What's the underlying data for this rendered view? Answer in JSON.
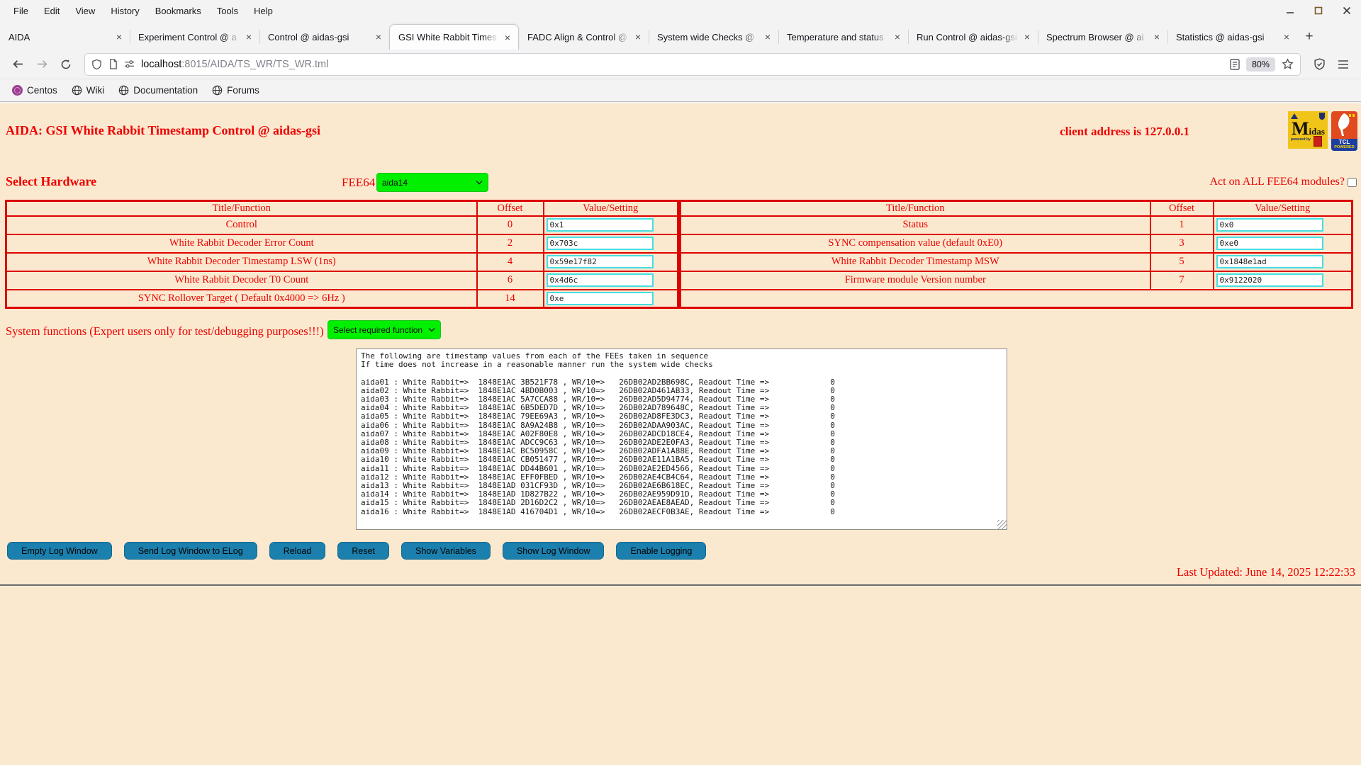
{
  "browser": {
    "menu_items": [
      "File",
      "Edit",
      "View",
      "History",
      "Bookmarks",
      "Tools",
      "Help"
    ],
    "tabs": [
      {
        "title": "AIDA"
      },
      {
        "title": "Experiment Control @ a"
      },
      {
        "title": "Control @ aidas-gsi"
      },
      {
        "title": "GSI White Rabbit Times"
      },
      {
        "title": "FADC Align & Control @"
      },
      {
        "title": "System wide Checks @"
      },
      {
        "title": "Temperature and status"
      },
      {
        "title": "Run Control @ aidas-gsi"
      },
      {
        "title": "Spectrum Browser @ ai"
      },
      {
        "title": "Statistics @ aidas-gsi"
      }
    ],
    "close_glyph": "×",
    "new_tab_label": "+",
    "address": {
      "host": "localhost",
      "rest": ":8015/AIDA/TS_WR/TS_WR.tml"
    },
    "zoom_badge": "80%",
    "bookmarks": [
      "Centos",
      "Wiki",
      "Documentation",
      "Forums"
    ]
  },
  "page": {
    "title": "AIDA: GSI White Rabbit Timestamp Control @ aidas-gsi",
    "client_address": "client address is 127.0.0.1",
    "logos": {
      "midas_text": "Midas",
      "midas_powered": "powered by",
      "tcl_line1": "TCL",
      "tcl_line2": "POWERED"
    },
    "hardware": {
      "label": "Select Hardware",
      "fee_label": "FEE64",
      "fee_value": "aida14",
      "act_all_label": "Act on ALL FEE64 modules?"
    },
    "table": {
      "headers": [
        "Title/Function",
        "Offset",
        "Value/Setting"
      ],
      "left_rows": [
        {
          "title": "Control",
          "offset": "0",
          "value": "0x1"
        },
        {
          "title": "White Rabbit Decoder Error Count",
          "offset": "2",
          "value": "0x703c"
        },
        {
          "title": "White Rabbit Decoder Timestamp LSW (1ns)",
          "offset": "4",
          "value": "0x59e17f82"
        },
        {
          "title": "White Rabbit Decoder T0 Count",
          "offset": "6",
          "value": "0x4d6c"
        },
        {
          "title": "SYNC Rollover Target ( Default 0x4000 => 6Hz )",
          "offset": "14",
          "value": "0xe"
        }
      ],
      "right_rows": [
        {
          "title": "Status",
          "offset": "1",
          "value": "0x0"
        },
        {
          "title": "SYNC compensation value (default 0xE0)",
          "offset": "3",
          "value": "0xe0"
        },
        {
          "title": "White Rabbit Decoder Timestamp MSW",
          "offset": "5",
          "value": "0x1848e1ad"
        },
        {
          "title": "Firmware module Version number",
          "offset": "7",
          "value": "0x9122020"
        }
      ]
    },
    "system_functions": {
      "label": "System functions (Expert users only for test/debugging purposes!!!)",
      "selected": "Select required function"
    },
    "log_text": "The following are timestamp values from each of the FEEs taken in sequence\nIf time does not increase in a reasonable manner run the system wide checks\n\naida01 : White Rabbit=>  1848E1AC 3B521F78 , WR/10=>   26DB02AD2BB698C, Readout Time =>             0\naida02 : White Rabbit=>  1848E1AC 4BD0B003 , WR/10=>   26DB02AD461AB33, Readout Time =>             0\naida03 : White Rabbit=>  1848E1AC 5A7CCA88 , WR/10=>   26DB02AD5D94774, Readout Time =>             0\naida04 : White Rabbit=>  1848E1AC 6B5DED7D , WR/10=>   26DB02AD789648C, Readout Time =>             0\naida05 : White Rabbit=>  1848E1AC 79EE69A3 , WR/10=>   26DB02AD8FE3DC3, Readout Time =>             0\naida06 : White Rabbit=>  1848E1AC 8A9A24B8 , WR/10=>   26DB02ADAA903AC, Readout Time =>             0\naida07 : White Rabbit=>  1848E1AC A02F80E8 , WR/10=>   26DB02ADCD18CE4, Readout Time =>             0\naida08 : White Rabbit=>  1848E1AC ADCC9C63 , WR/10=>   26DB02ADE2E0FA3, Readout Time =>             0\naida09 : White Rabbit=>  1848E1AC BC50958C , WR/10=>   26DB02ADFA1A88E, Readout Time =>             0\naida10 : White Rabbit=>  1848E1AC CB051477 , WR/10=>   26DB02AE11A1BA5, Readout Time =>             0\naida11 : White Rabbit=>  1848E1AC DD44B601 , WR/10=>   26DB02AE2ED4566, Readout Time =>             0\naida12 : White Rabbit=>  1848E1AC EFF0FBED , WR/10=>   26DB02AE4CB4C64, Readout Time =>             0\naida13 : White Rabbit=>  1848E1AD 031CF93D , WR/10=>   26DB02AE6B618EC, Readout Time =>             0\naida14 : White Rabbit=>  1848E1AD 1D827B22 , WR/10=>   26DB02AE959D91D, Readout Time =>             0\naida15 : White Rabbit=>  1848E1AD 2D16D2C2 , WR/10=>   26DB02AEAE8AEAD, Readout Time =>             0\naida16 : White Rabbit=>  1848E1AD 416704D1 , WR/10=>   26DB02AECF0B3AE, Readout Time =>             0",
    "buttons": [
      "Empty Log Window",
      "Send Log Window to ELog",
      "Reload",
      "Reset",
      "Show Variables",
      "Show Log Window",
      "Enable Logging"
    ],
    "last_updated": "Last Updated: June 14, 2025 12:22:33"
  }
}
